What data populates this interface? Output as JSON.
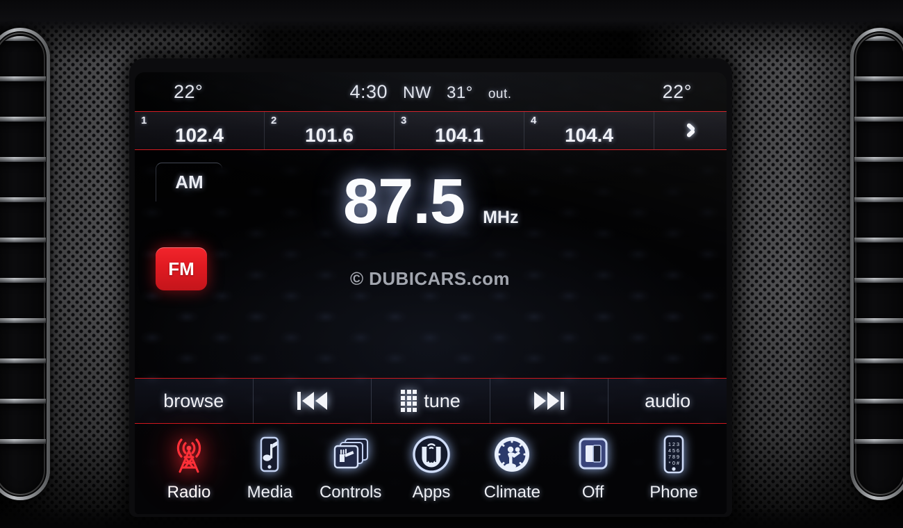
{
  "statusbar": {
    "left_temp": "22°",
    "clock": "4:30",
    "direction": "NW",
    "outside_temp": "31°",
    "outside_label": "out.",
    "right_temp": "22°"
  },
  "presets": [
    {
      "num": "1",
      "freq": "102.4"
    },
    {
      "num": "2",
      "freq": "101.6"
    },
    {
      "num": "3",
      "freq": "104.1"
    },
    {
      "num": "4",
      "freq": "104.4"
    }
  ],
  "preset_next_icon": "chevron-right-icon",
  "band": {
    "am_label": "AM",
    "fm_label": "FM",
    "active": "FM",
    "active_color": "#e01a21"
  },
  "tuner": {
    "frequency": "87.5",
    "unit": "MHz"
  },
  "watermark": "© DUBICARS.com",
  "controls": [
    {
      "label": "browse",
      "icon": ""
    },
    {
      "label": "",
      "icon": "prev-track-icon"
    },
    {
      "label": "tune",
      "icon": "keypad-icon"
    },
    {
      "label": "",
      "icon": "next-track-icon"
    },
    {
      "label": "audio",
      "icon": ""
    }
  ],
  "nav": [
    {
      "label": "Radio",
      "icon": "radio-tower-icon",
      "active": true
    },
    {
      "label": "Media",
      "icon": "media-phone-note-icon",
      "active": false
    },
    {
      "label": "Controls",
      "icon": "controls-cards-icon",
      "active": false
    },
    {
      "label": "Apps",
      "icon": "uconnect-apps-icon",
      "active": false
    },
    {
      "label": "Climate",
      "icon": "climate-person-icon",
      "active": false
    },
    {
      "label": "Off",
      "icon": "screen-off-icon",
      "active": false
    },
    {
      "label": "Phone",
      "icon": "phone-keypad-icon",
      "active": false
    }
  ],
  "theme": {
    "accent_red": "#d41a20",
    "text": "#eef0f5",
    "screen_bg": "#07070a"
  }
}
